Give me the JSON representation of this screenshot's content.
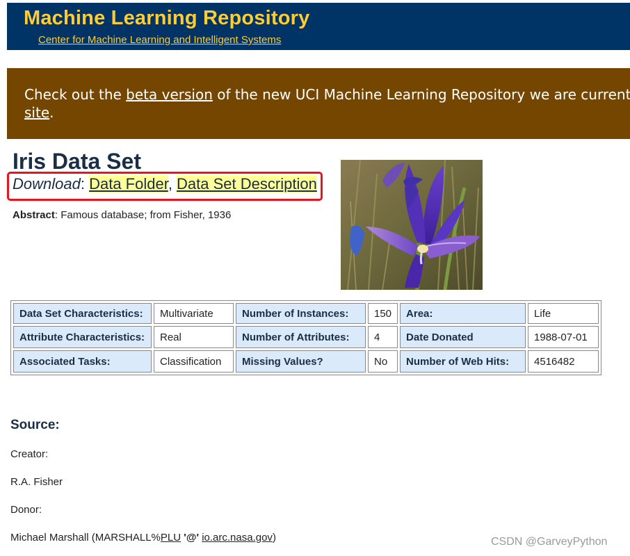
{
  "header": {
    "title": "Machine Learning Repository",
    "subtitle": "Center for Machine Learning and Intelligent Systems"
  },
  "banner": {
    "prefix": "Check out the ",
    "link_beta": "beta version",
    "middle": " of the new UCI Machine Learning Repository we are currently te",
    "link_site": "site",
    "suffix": "."
  },
  "dataset": {
    "title": "Iris Data Set",
    "download_label": "Download",
    "download_sep": ": ",
    "link_folder": "Data Folder",
    "link_sep": ", ",
    "link_description": "Data Set Description",
    "abstract_label": "Abstract",
    "abstract_text": ": Famous database; from Fisher, 1936"
  },
  "characteristics": {
    "rows": [
      [
        {
          "k": "Data Set Characteristics:",
          "v": "Multivariate"
        },
        {
          "k": "Number of Instances:",
          "v": "150"
        },
        {
          "k": "Area:",
          "v": "Life"
        }
      ],
      [
        {
          "k": "Attribute Characteristics:",
          "v": "Real"
        },
        {
          "k": "Number of Attributes:",
          "v": "4"
        },
        {
          "k": "Date Donated",
          "v": "1988-07-01"
        }
      ],
      [
        {
          "k": "Associated Tasks:",
          "v": "Classification"
        },
        {
          "k": "Missing Values?",
          "v": "No"
        },
        {
          "k": "Number of Web Hits:",
          "v": "4516482"
        }
      ]
    ]
  },
  "source": {
    "heading": "Source:",
    "creator_label": "Creator:",
    "creator_name": "R.A. Fisher",
    "donor_label": "Donor:",
    "donor_prefix": "Michael Marshall (MARSHALL%",
    "donor_link_1": "PLU",
    "donor_at": " '@' ",
    "donor_link_2": "io.arc.nasa.gov",
    "donor_suffix": ")"
  },
  "watermark": "CSDN @GarveyPython",
  "colors": {
    "header_bg": "#003366",
    "header_text": "#ffcc33",
    "banner_bg": "#744600",
    "highlight_link_bg": "#ffff99",
    "table_key_bg": "#dbeafa",
    "annotation_box": "#e8141e"
  }
}
